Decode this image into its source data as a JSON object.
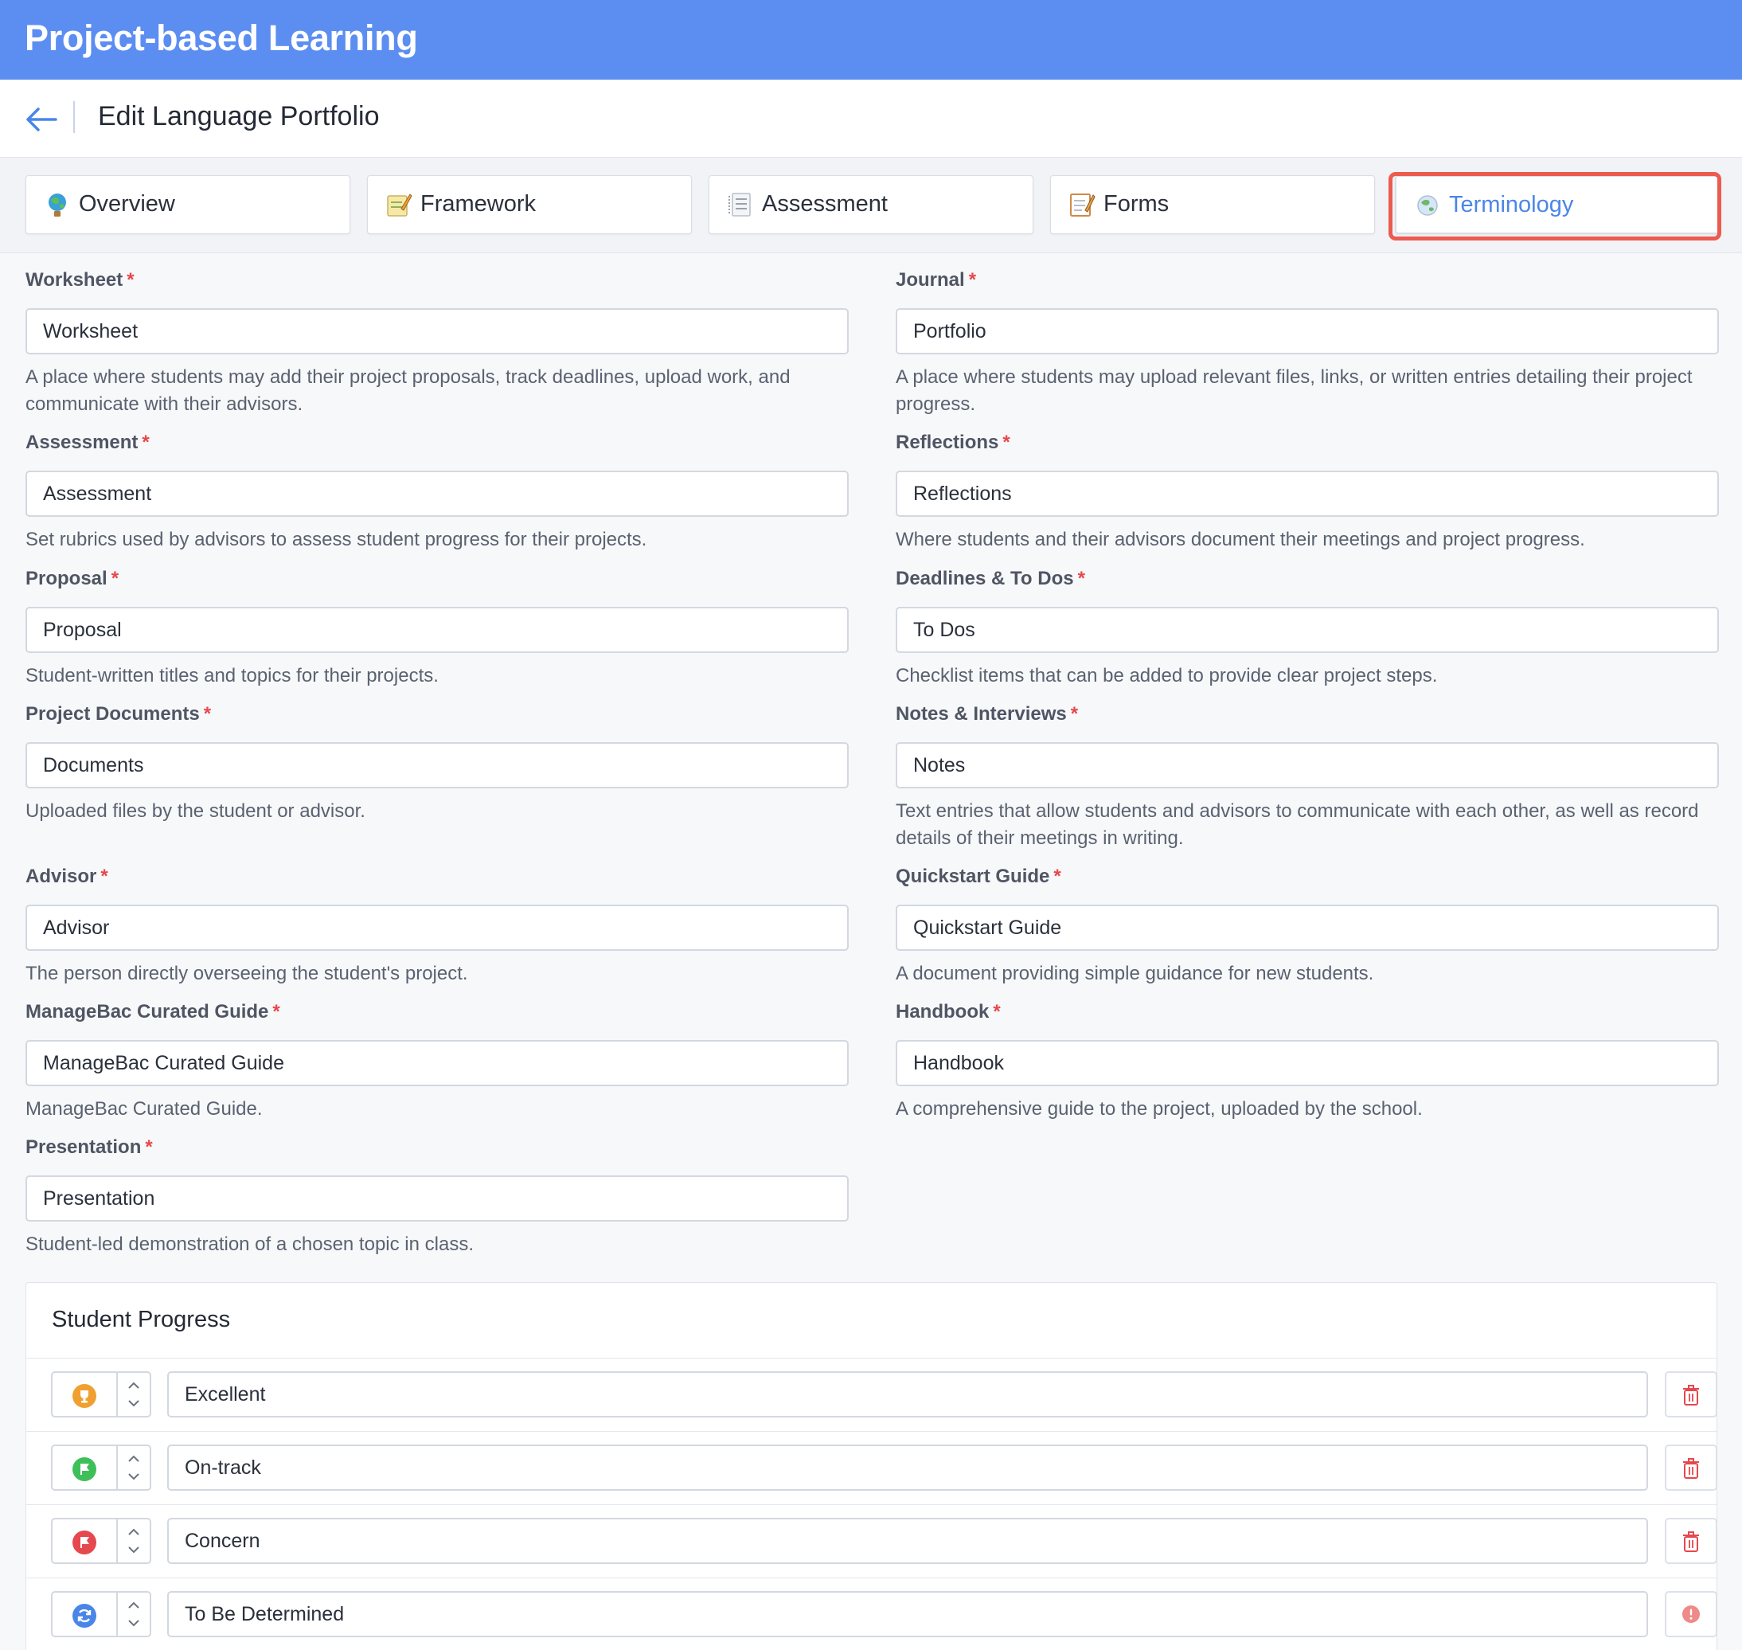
{
  "app": {
    "title": "Project-based Learning"
  },
  "page": {
    "title": "Edit Language Portfolio"
  },
  "tabs": [
    {
      "label": "Overview",
      "icon": "globe-plant-icon"
    },
    {
      "label": "Framework",
      "icon": "notepad-pencil-icon"
    },
    {
      "label": "Assessment",
      "icon": "document-list-icon"
    },
    {
      "label": "Forms",
      "icon": "memo-icon"
    },
    {
      "label": "Terminology",
      "icon": "globe-icon",
      "active": true
    }
  ],
  "fields": {
    "worksheet": {
      "label": "Worksheet",
      "value": "Worksheet",
      "help": "A place where students may add their project proposals, track deadlines, upload work, and communicate with their advisors."
    },
    "journal": {
      "label": "Journal",
      "value": "Portfolio",
      "help": "A place where students may upload relevant files, links, or written entries detailing their project progress."
    },
    "assessment": {
      "label": "Assessment",
      "value": "Assessment",
      "help": "Set rubrics used by advisors to assess student progress for their projects."
    },
    "reflections": {
      "label": "Reflections",
      "value": "Reflections",
      "help": "Where students and their advisors document their meetings and project progress."
    },
    "proposal": {
      "label": "Proposal",
      "value": "Proposal",
      "help": "Student-written titles and topics for their projects."
    },
    "deadlines": {
      "label": "Deadlines & To Dos",
      "value": "To Dos",
      "help": "Checklist items that can be added to provide clear project steps."
    },
    "documents": {
      "label": "Project Documents",
      "value": "Documents",
      "help": "Uploaded files by the student or advisor."
    },
    "notes": {
      "label": "Notes & Interviews",
      "value": "Notes",
      "help": "Text entries that allow students and advisors to communicate with each other, as well as record details of their meetings in writing."
    },
    "advisor": {
      "label": "Advisor",
      "value": "Advisor",
      "help": "The person directly overseeing the student's project."
    },
    "quickstart": {
      "label": "Quickstart Guide",
      "value": "Quickstart Guide",
      "help": "A document providing simple guidance for new students."
    },
    "curated": {
      "label": "ManageBac Curated Guide",
      "value": "ManageBac Curated Guide",
      "help": "ManageBac Curated Guide."
    },
    "handbook": {
      "label": "Handbook",
      "value": "Handbook",
      "help": "A comprehensive guide to the project, uploaded by the school."
    },
    "presentation": {
      "label": "Presentation",
      "value": "Presentation",
      "help": "Student-led demonstration of a chosen topic in class."
    }
  },
  "required_marker": "*",
  "progress": {
    "title": "Student Progress",
    "items": [
      {
        "value": "Excellent",
        "icon": "trophy-icon",
        "color": "#f0a030",
        "action": "delete"
      },
      {
        "value": "On-track",
        "icon": "flag-icon",
        "color": "#3fbf5a",
        "action": "delete"
      },
      {
        "value": "Concern",
        "icon": "flag-icon",
        "color": "#e5484d",
        "action": "delete"
      },
      {
        "value": "To Be Determined",
        "icon": "refresh-icon",
        "color": "#4a86e8",
        "action": "locked"
      }
    ]
  },
  "colors": {
    "header": "#5c8ef2",
    "active_tab": "#4a86e8",
    "highlight": "#ec5b4f",
    "required": "#e5484d"
  }
}
